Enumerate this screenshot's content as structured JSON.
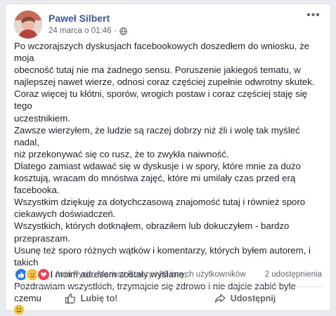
{
  "post": {
    "author": "Paweł Silbert",
    "timestamp": "24 marca o 01:46",
    "separator": "·",
    "more_label": "•••",
    "lines": [
      "Po wczorajszych dyskusjach facebookowych doszedłem do wniosku, że moja",
      "obecność tutaj nie ma żadnego sensu. Poruszenie jakiegoś tematu, w",
      "najlepszej nawet wierze, odnosi coraz częściej zupełnie odwrotny skutek.",
      "Coraz więcej tu kłótni, sporów, wrogich postaw i coraz częściej staję się tego",
      "uczestnikiem.",
      "Zawsze wierzyłem, że ludzie są raczej dobrzy niż źli i wolę tak myśleć nadal,",
      "niż przekonywać się co rusz, że to zwykła naiwność.",
      "Dlatego zamiast wdawać się w dyskusje i w spory, które mnie za dużo",
      "kosztują, wracam do mnóstwa zajęć, które mi umilały czas przed erą",
      "facebooka.",
      "Wszystkim dziękuję za dotychczasową znajomość tutaj i również sporo",
      "ciekawych doświadczeń.",
      "Wszystkich, których dotknąłem, obraziłem lub dokuczyłem - bardzo",
      "przepraszam.",
      "Usunę też sporo różnych wątków i komentarzy, których byłem autorem, i takich",
      "które pod moim adresem zostały wysłane.",
      "Pozdrawiam wszystkich, trzymajcie się zdrowo i nie dajcie zabić byle czemu"
    ],
    "emoji_icon": "smile-emoji-icon"
  },
  "reactions": {
    "icons": [
      "like-reaction-icon",
      "sad-reaction-icon",
      "love-reaction-icon"
    ],
    "colors": {
      "like": "#2078f4",
      "sad": "#f5c33b",
      "love": "#f33e58"
    },
    "summary": "Ania Pycia, Mariusz Burczy i 88 innych użytkowników",
    "shares": "2 udostępnienia"
  },
  "actions": {
    "like_label": "Lubię to!",
    "share_label": "Udostępnij"
  },
  "colors": {
    "author_link": "#385898",
    "text": "#1d2129",
    "muted": "#606770",
    "background": "#e9ebee"
  }
}
